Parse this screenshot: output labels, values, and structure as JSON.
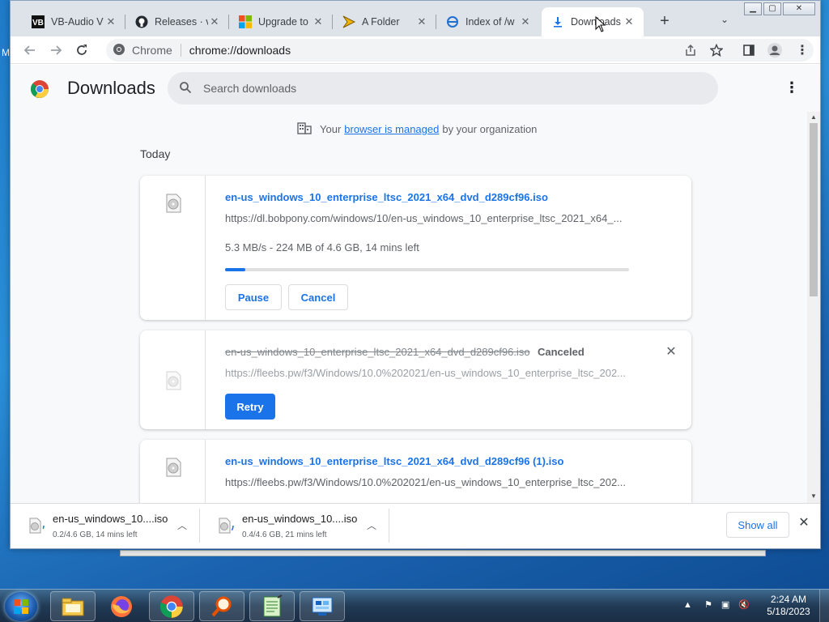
{
  "browser": {
    "tabs": [
      {
        "title": "VB-Audio V",
        "icon": "vb-audio-icon"
      },
      {
        "title": "Releases · v",
        "icon": "github-icon"
      },
      {
        "title": "Upgrade to",
        "icon": "windows-logo-icon"
      },
      {
        "title": "A Folder",
        "icon": "folder-arrow-icon"
      },
      {
        "title": "Index of /w",
        "icon": "ie-icon"
      },
      {
        "title": "Downloads",
        "icon": "download-icon"
      }
    ],
    "address": {
      "origin": "Chrome",
      "url": "chrome://downloads"
    }
  },
  "page": {
    "title": "Downloads",
    "search_placeholder": "Search downloads",
    "managed": {
      "prefix": "Your",
      "link": "browser is managed",
      "suffix": "by your organization"
    },
    "section": "Today",
    "downloads": [
      {
        "filename": "en-us_windows_10_enterprise_ltsc_2021_x64_dvd_d289cf96.iso",
        "url": "https://dl.bobpony.com/windows/10/en-us_windows_10_enterprise_ltsc_2021_x64_...",
        "status": "5.3 MB/s - 224 MB of 4.6 GB, 14 mins left",
        "progress": 0.05,
        "actions": [
          "Pause",
          "Cancel"
        ]
      },
      {
        "filename": "en-us_windows_10_enterprise_ltsc_2021_x64_dvd_d289cf96.iso",
        "state": "Canceled",
        "url": "https://fleebs.pw/f3/Windows/10.0%202021/en-us_windows_10_enterprise_ltsc_202...",
        "actions": [
          "Retry"
        ]
      },
      {
        "filename": "en-us_windows_10_enterprise_ltsc_2021_x64_dvd_d289cf96 (1).iso",
        "url": "https://fleebs.pw/f3/Windows/10.0%202021/en-us_windows_10_enterprise_ltsc_202..."
      }
    ]
  },
  "shelf": {
    "items": [
      {
        "name": "en-us_windows_10....iso",
        "status": "0.2/4.6 GB, 14 mins left"
      },
      {
        "name": "en-us_windows_10....iso",
        "status": "0.4/4.6 GB, 21 mins left"
      }
    ],
    "show_all": "Show all"
  },
  "desktop": {
    "edge_text": "M"
  },
  "taskbar": {
    "apps": [
      "explorer-icon",
      "firefox-icon",
      "chrome-icon",
      "magnifier-icon",
      "notepad-icon",
      "control-panel-icon"
    ],
    "time": "2:24 AM",
    "date": "5/18/2023"
  },
  "colors": {
    "accent": "#1a73e8",
    "tabstrip": "#dee3ea",
    "page_bg": "#f8f9fa"
  }
}
